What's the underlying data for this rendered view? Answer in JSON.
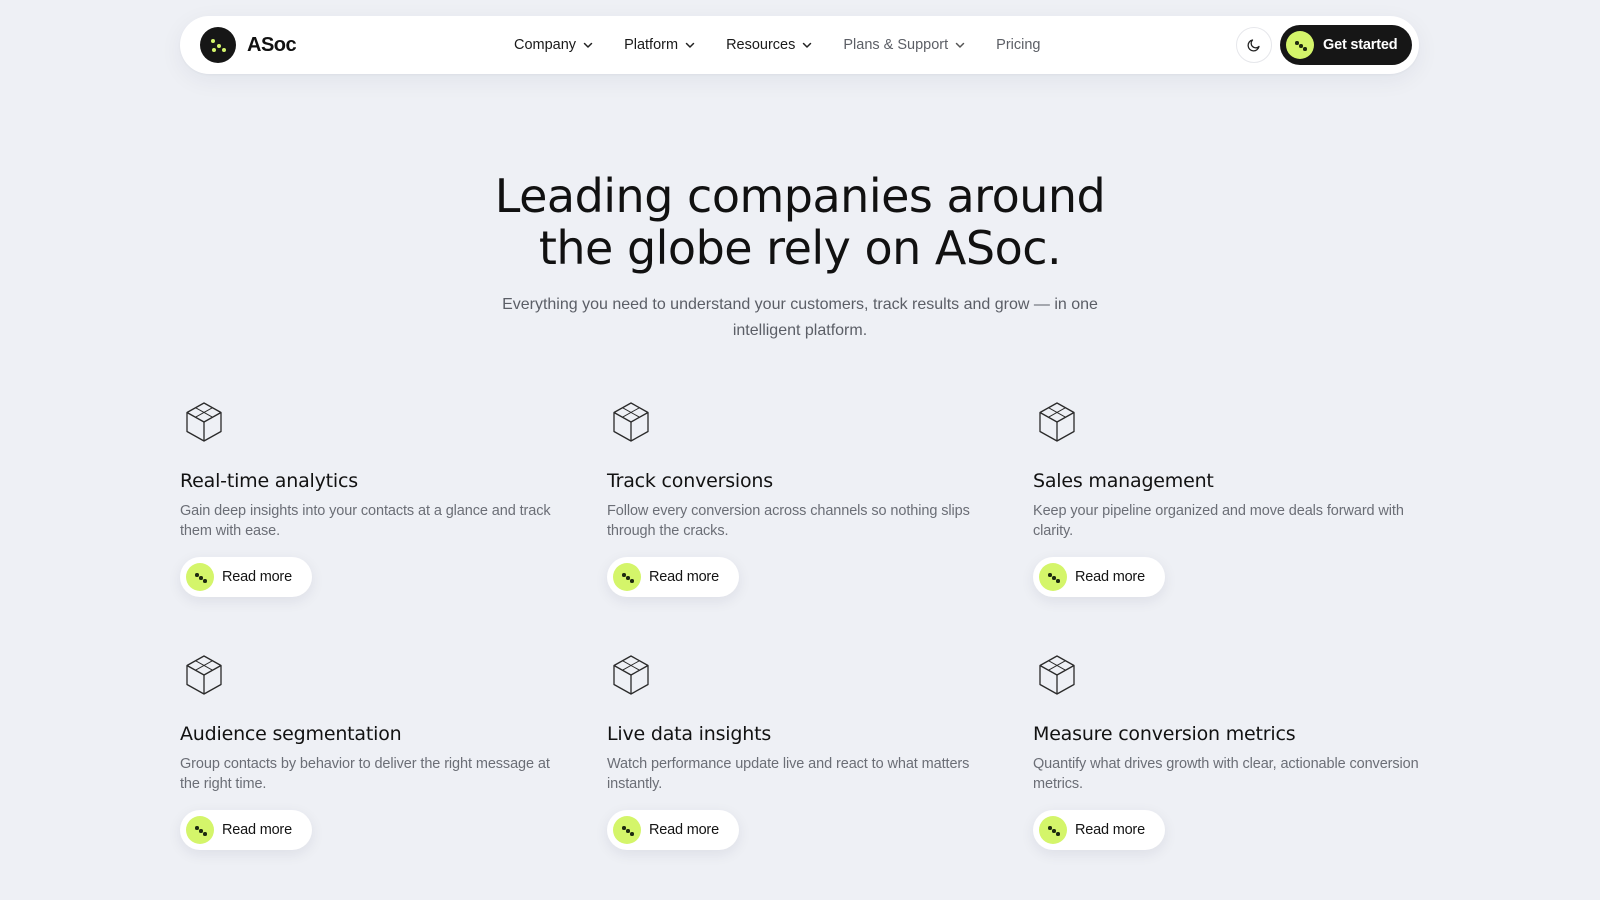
{
  "colors": {
    "background": "#eef0f5",
    "brand_dark": "#161616",
    "accent_lime": "#d4f56a",
    "muted_text": "#6b6e76"
  },
  "brand": {
    "name": "ASoc",
    "icon": "brand-logo-dots"
  },
  "nav": {
    "items": [
      {
        "label": "Company",
        "has_dropdown": true
      },
      {
        "label": "Platform",
        "has_dropdown": true
      },
      {
        "label": "Resources",
        "has_dropdown": true
      },
      {
        "label": "Plans & Support",
        "has_dropdown": true
      },
      {
        "label": "Pricing",
        "has_dropdown": false
      }
    ],
    "theme_toggle_icon": "moon-icon",
    "cta_label": "Get started"
  },
  "hero": {
    "title_line1": "Leading companies around",
    "title_line2": "the globe rely on ASoc.",
    "subtitle": "Everything you need to understand your customers, track results and grow — in one intelligent platform."
  },
  "features": [
    {
      "icon": "cube-icon",
      "title": "Real-time analytics",
      "description": "Gain deep insights into your contacts at a glance and track them with ease.",
      "cta": "Read more"
    },
    {
      "icon": "cube-icon",
      "title": "Track conversions",
      "description": "Follow every conversion across channels so nothing slips through the cracks.",
      "cta": "Read more"
    },
    {
      "icon": "cube-icon",
      "title": "Sales management",
      "description": "Keep your pipeline organized and move deals forward with clarity.",
      "cta": "Read more"
    },
    {
      "icon": "cube-icon",
      "title": "Audience segmentation",
      "description": "Group contacts by behavior to deliver the right message at the right time.",
      "cta": "Read more"
    },
    {
      "icon": "cube-icon",
      "title": "Live data insights",
      "description": "Watch performance update live and react to what matters instantly.",
      "cta": "Read more"
    },
    {
      "icon": "cube-icon",
      "title": "Measure conversion metrics",
      "description": "Quantify what drives growth with clear, actionable conversion metrics.",
      "cta": "Read more"
    }
  ]
}
